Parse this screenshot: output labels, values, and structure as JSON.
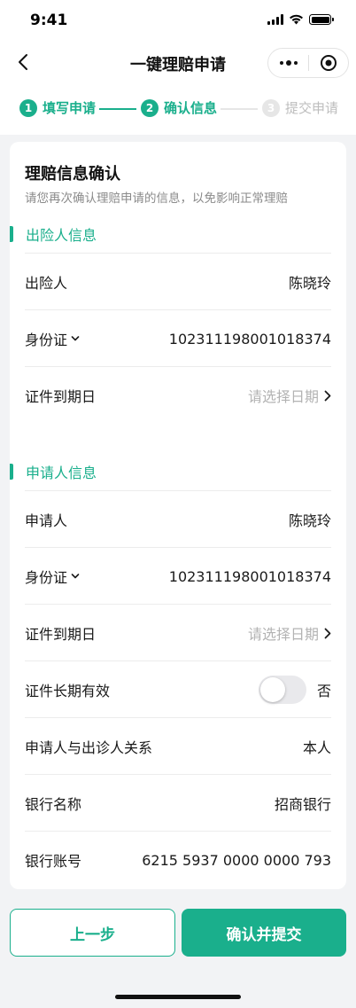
{
  "status_bar": {
    "time": "9:41"
  },
  "nav": {
    "title": "一键理赔申请"
  },
  "steps": [
    {
      "num": "1",
      "label": "填写申请",
      "state": "done"
    },
    {
      "num": "2",
      "label": "确认信息",
      "state": "active"
    },
    {
      "num": "3",
      "label": "提交申请",
      "state": "pending"
    }
  ],
  "card": {
    "title": "理赔信息确认",
    "subtitle": "请您再次确认理赔申请的信息，以免影响正常理赔"
  },
  "insured": {
    "heading": "出险人信息",
    "name_label": "出险人",
    "name_value": "陈晓玲",
    "id_type_label": "身份证",
    "id_number": "102311198001018374",
    "expiry_label": "证件到期日",
    "expiry_placeholder": "请选择日期"
  },
  "applicant": {
    "heading": "申请人信息",
    "name_label": "申请人",
    "name_value": "陈晓玲",
    "id_type_label": "身份证",
    "id_number": "102311198001018374",
    "expiry_label": "证件到期日",
    "expiry_placeholder": "请选择日期",
    "long_term_label": "证件长期有效",
    "long_term_value": "否",
    "relation_label": "申请人与出诊人关系",
    "relation_value": "本人",
    "bank_name_label": "银行名称",
    "bank_name_value": "招商银行",
    "bank_account_label": "银行账号",
    "bank_account_value": "6215 5937 0000 0000 793"
  },
  "buttons": {
    "prev_label": "上一步",
    "submit_label": "确认并提交"
  },
  "colors": {
    "accent": "#1aaf8c",
    "placeholder": "#b3b3b3",
    "page_bg": "#f2f3f5"
  }
}
